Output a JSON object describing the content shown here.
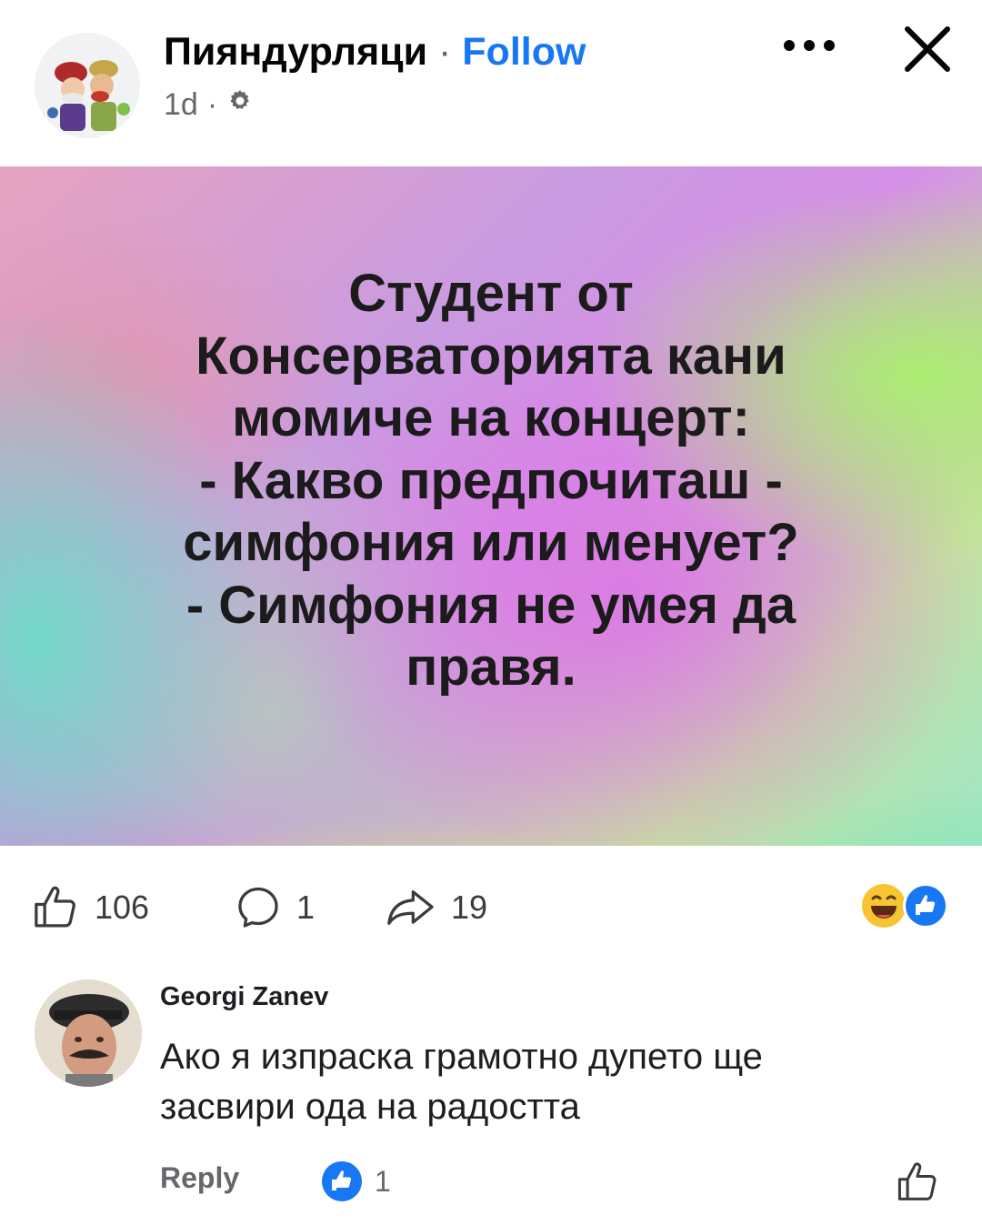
{
  "header": {
    "page_name": "Пияндурляци",
    "separator": "·",
    "follow_label": "Follow",
    "time": "1d",
    "meta_separator": "·",
    "privacy_icon": "gear-icon",
    "more_icon": "more-horizontal-icon",
    "close_icon": "close-icon"
  },
  "post": {
    "text_lines": [
      "Студент от",
      "Консерваторията кани",
      "момиче на концерт:",
      "- Какво предпочиташ -",
      "симфония или менует?",
      "- Симфония не умея да",
      "правя."
    ]
  },
  "actions": {
    "likes": "106",
    "comments": "1",
    "shares": "19",
    "reaction_icons": [
      "haha-emoji-icon",
      "like-reaction-icon"
    ]
  },
  "comment": {
    "author": "Georgi Zanev",
    "text_lines": [
      "Ако я изпраска грамотно дупето ще",
      "засвири ода на радостта"
    ],
    "reply_label": "Reply",
    "reaction_count": "1"
  },
  "colors": {
    "accent": "#1877f2",
    "secondary_text": "#65676b",
    "primary_text": "#050505"
  }
}
